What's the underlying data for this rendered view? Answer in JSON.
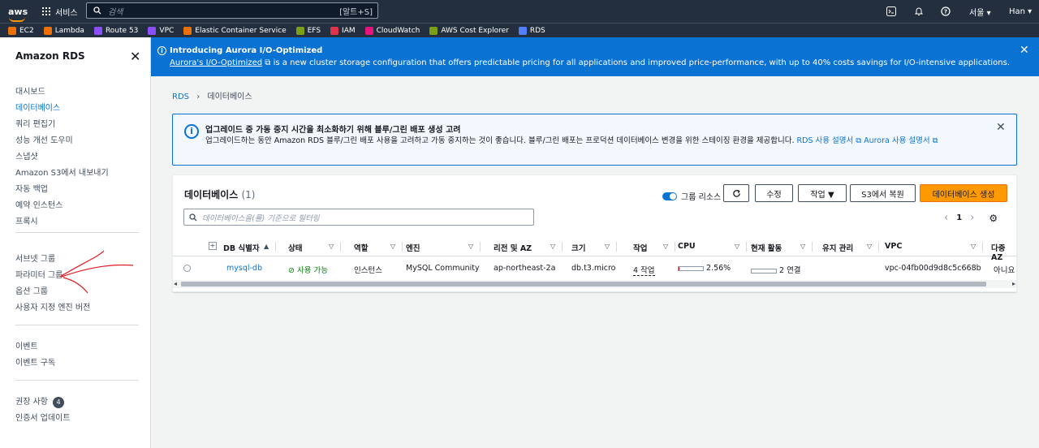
{
  "topnav": {
    "logo": "aws",
    "services_label": "서비스",
    "search_placeholder": "검색",
    "search_shortcut": "[알트+S]",
    "region": "서울 ▾",
    "user": "Han ▾"
  },
  "favorites": [
    {
      "label": "EC2",
      "color": "#ed7100"
    },
    {
      "label": "Lambda",
      "color": "#ed7100"
    },
    {
      "label": "Route 53",
      "color": "#8c4fff"
    },
    {
      "label": "VPC",
      "color": "#8c4fff"
    },
    {
      "label": "Elastic Container Service",
      "color": "#ed7100"
    },
    {
      "label": "EFS",
      "color": "#7aa116"
    },
    {
      "label": "IAM",
      "color": "#dd344c"
    },
    {
      "label": "CloudWatch",
      "color": "#e7157b"
    },
    {
      "label": "AWS Cost Explorer",
      "color": "#7aa116"
    },
    {
      "label": "RDS",
      "color": "#527fff"
    }
  ],
  "sidebar": {
    "title": "Amazon RDS",
    "group1": [
      "대시보드",
      "데이터베이스",
      "쿼리 편집기",
      "성능 개선 도우미",
      "스냅샷",
      "Amazon S3에서 내보내기",
      "자동 백업",
      "예약 인스턴스",
      "프록시"
    ],
    "group2": [
      "서브넷 그룹",
      "파라미터 그룹",
      "옵션 그룹",
      "사용자 지정 엔진 버전"
    ],
    "group3": [
      "이벤트",
      "이벤트 구독"
    ],
    "group4_rec": "권장 사항",
    "group4_rec_count": "4",
    "group4_cert": "인증서 업데이트"
  },
  "banner": {
    "title": "Introducing Aurora I/O-Optimized",
    "link": "Aurora's I/O-Optimized",
    "text": " is a new cluster storage configuration that offers predictable pricing for all applications and improved price-performance, with up to 40% costs savings for I/O-intensive applications."
  },
  "breadcrumb": {
    "root": "RDS",
    "current": "데이터베이스"
  },
  "alert": {
    "title": "업그레이드 중 가동 중지 시간을 최소화하기 위해 블루/그린 배포 생성 고려",
    "body": "업그레이드하는 동안 Amazon RDS 블루/그린 배포 사용을 고려하고 가동 중지하는 것이 좋습니다. 블루/그린 배포는 프로덕션 데이터베이스 변경을 위한 스테이징 환경을 제공합니다.",
    "link1": "RDS 사용 설명서",
    "link2": "Aurora 사용 설명서"
  },
  "panel": {
    "title": "데이터베이스",
    "count": "(1)",
    "toggle_label": "그룹 리소스",
    "btn_modify": "수정",
    "btn_actions": "작업 ▼",
    "btn_restore": "S3에서 복원",
    "btn_create": "데이터베이스 생성",
    "filter_placeholder": "데이터베이스을(를) 기준으로 필터링",
    "page": "1"
  },
  "columns": [
    "DB 식별자",
    "상태",
    "역할",
    "엔진",
    "리전 및 AZ",
    "크기",
    "작업",
    "CPU",
    "현재 활동",
    "유지 관리",
    "VPC",
    "다중 AZ"
  ],
  "row": {
    "id": "mysql-db",
    "status": "사용 가능",
    "role": "인스턴스",
    "engine": "MySQL Community",
    "az": "ap-northeast-2a",
    "size": "db.t3.micro",
    "actions": "4 작업",
    "cpu": "2.56%",
    "cpu_fraction": 0.0256,
    "activity": "2 연결",
    "maintenance": "",
    "vpc": "vpc-04fb00d9d8c5c668b",
    "multi_az": "아니요"
  }
}
